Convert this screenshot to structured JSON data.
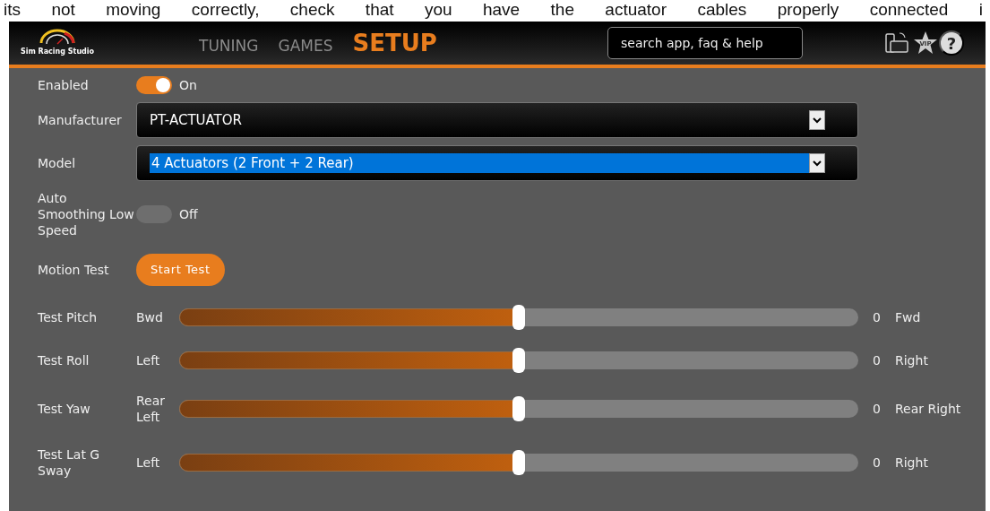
{
  "document_text": "its not moving correctly, check that you have the actuator cables properly connected i",
  "header": {
    "logo_text": "Sim Racing Studio",
    "tabs": [
      {
        "label": "TUNING",
        "selected": false
      },
      {
        "label": "GAMES",
        "selected": false
      },
      {
        "label": "SETUP",
        "selected": true
      }
    ],
    "search": {
      "placeholder": "search app, faq & help"
    },
    "vip_label": "VIP",
    "help_label": "?"
  },
  "settings": [
    {
      "kind": "toggle",
      "label": "Enabled",
      "on": true,
      "state_text": "On"
    },
    {
      "kind": "select",
      "label": "Manufacturer",
      "value": "PT-ACTUATOR",
      "highlighted": false
    },
    {
      "kind": "select",
      "label": "Model",
      "value": "4 Actuators (2 Front + 2 Rear)",
      "highlighted": true
    },
    {
      "kind": "toggle",
      "label": "Auto Smoothing Low Speed",
      "on": false,
      "state_text": "Off"
    },
    {
      "kind": "button",
      "label": "Motion Test",
      "button": "Start Test"
    },
    {
      "kind": "slider",
      "label": "Test Pitch",
      "min_label": "Bwd",
      "level": 0.5,
      "reading": "0",
      "max_label": "Fwd"
    },
    {
      "kind": "slider",
      "label": "Test Roll",
      "min_label": "Left",
      "level": 0.5,
      "reading": "0",
      "max_label": "Right"
    },
    {
      "kind": "slider",
      "label": "Test Yaw",
      "min_label": "Rear Left",
      "level": 0.5,
      "reading": "0",
      "max_label": "Rear Right"
    },
    {
      "kind": "slider",
      "label": "Test Lat G Sway",
      "min_label": "Left",
      "level": 0.5,
      "reading": "0",
      "max_label": "Right"
    }
  ]
}
